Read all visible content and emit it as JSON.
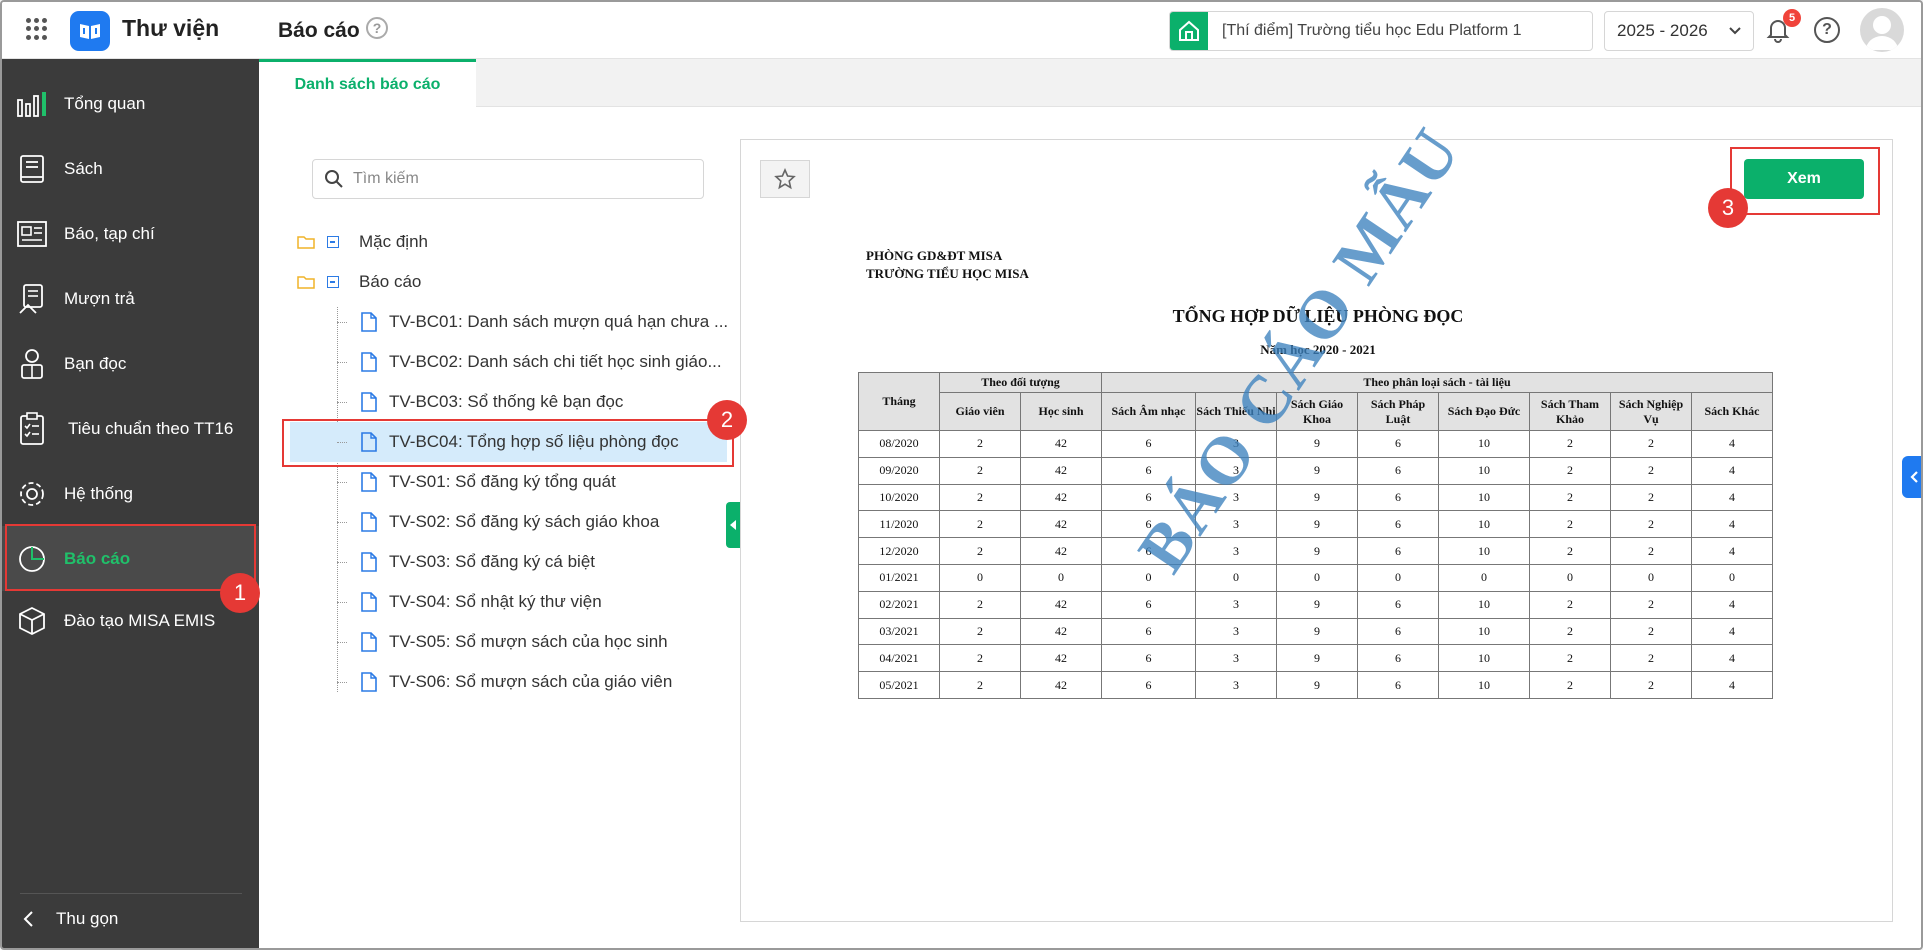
{
  "app": {
    "title": "Thư viện",
    "page_title": "Báo cáo",
    "help_symbol": "?"
  },
  "header": {
    "school": "[Thí điểm] Trường tiểu học Edu Platform 1",
    "year": "2025 - 2026",
    "notifications": "5",
    "help_symbol": "?"
  },
  "sidebar": {
    "items": [
      {
        "label": "Tổng quan",
        "icon": "dashboard-icon"
      },
      {
        "label": "Sách",
        "icon": "book-icon"
      },
      {
        "label": "Báo, tạp chí",
        "icon": "newspaper-icon"
      },
      {
        "label": "Mượn trả",
        "icon": "borrow-return-icon"
      },
      {
        "label": "Bạn đọc",
        "icon": "reader-icon"
      },
      {
        "label": "Tiêu chuẩn theo TT16",
        "icon": "clipboard-icon"
      },
      {
        "label": "Hệ thống",
        "icon": "gear-icon"
      },
      {
        "label": "Báo cáo",
        "icon": "pie-chart-icon",
        "active": true
      },
      {
        "label": "Đào tạo MISA EMIS",
        "icon": "cube-icon"
      }
    ],
    "collapse_label": "Thu gọn"
  },
  "tabs": [
    {
      "label": "Danh sách báo cáo",
      "active": true
    }
  ],
  "search": {
    "placeholder": "Tìm kiếm"
  },
  "tree": {
    "folders": [
      {
        "label": "Mặc định"
      },
      {
        "label": "Báo cáo"
      }
    ],
    "items": [
      "TV-BC01: Danh sách mượn quá hạn chưa ...",
      "TV-BC02: Danh sách chi tiết học sinh giáo...",
      "TV-BC03: Sổ thống kê bạn đọc",
      "TV-BC04: Tổng hợp số liệu phòng đọc",
      "TV-S01: Sổ đăng ký tổng quát",
      "TV-S02: Sổ đăng ký sách giáo khoa",
      "TV-S03: Sổ đăng ký cá biệt",
      "TV-S04: Sổ nhật ký thư viện",
      "TV-S05: Sổ mượn sách của học sinh",
      "TV-S06: Sổ mượn sách của giáo viên"
    ],
    "selected_index": 3
  },
  "preview": {
    "view_button": "Xem",
    "watermark": "BÁO CÁO MẪU",
    "report": {
      "org_line1": "PHÒNG GD&ĐT MISA",
      "org_line2": "TRƯỜNG TIỂU HỌC MISA",
      "title": "TỔNG HỢP DỮ LIỆU PHÒNG ĐỌC",
      "subtitle": "Năm học 2020 - 2021",
      "group_headers": {
        "month": "Tháng",
        "by_subject": "Theo đối tượng",
        "by_category": "Theo phân loại sách - tài liệu"
      },
      "columns": [
        "Giáo viên",
        "Học sinh",
        "Sách Âm nhạc",
        "Sách Thiếu Nhi",
        "Sách Giáo Khoa",
        "Sách Pháp Luật",
        "Sách Đạo Đức",
        "Sách Tham Khảo",
        "Sách Nghiệp Vụ",
        "Sách Khác"
      ],
      "rows": [
        [
          "08/2020",
          "2",
          "42",
          "6",
          "3",
          "9",
          "6",
          "10",
          "2",
          "2",
          "4"
        ],
        [
          "09/2020",
          "2",
          "42",
          "6",
          "3",
          "9",
          "6",
          "10",
          "2",
          "2",
          "4"
        ],
        [
          "10/2020",
          "2",
          "42",
          "6",
          "3",
          "9",
          "6",
          "10",
          "2",
          "2",
          "4"
        ],
        [
          "11/2020",
          "2",
          "42",
          "6",
          "3",
          "9",
          "6",
          "10",
          "2",
          "2",
          "4"
        ],
        [
          "12/2020",
          "2",
          "42",
          "6",
          "3",
          "9",
          "6",
          "10",
          "2",
          "2",
          "4"
        ],
        [
          "01/2021",
          "0",
          "0",
          "0",
          "0",
          "0",
          "0",
          "0",
          "0",
          "0",
          "0"
        ],
        [
          "02/2021",
          "2",
          "42",
          "6",
          "3",
          "9",
          "6",
          "10",
          "2",
          "2",
          "4"
        ],
        [
          "03/2021",
          "2",
          "42",
          "6",
          "3",
          "9",
          "6",
          "10",
          "2",
          "2",
          "4"
        ],
        [
          "04/2021",
          "2",
          "42",
          "6",
          "3",
          "9",
          "6",
          "10",
          "2",
          "2",
          "4"
        ],
        [
          "05/2021",
          "2",
          "42",
          "6",
          "3",
          "9",
          "6",
          "10",
          "2",
          "2",
          "4"
        ]
      ]
    }
  },
  "annotations": [
    "1",
    "2",
    "3"
  ],
  "colors": {
    "accent": "#0bb06b",
    "sidebar_bg": "#3b3b3b",
    "highlight": "#e53935",
    "selected_row": "#d5ebfb"
  }
}
